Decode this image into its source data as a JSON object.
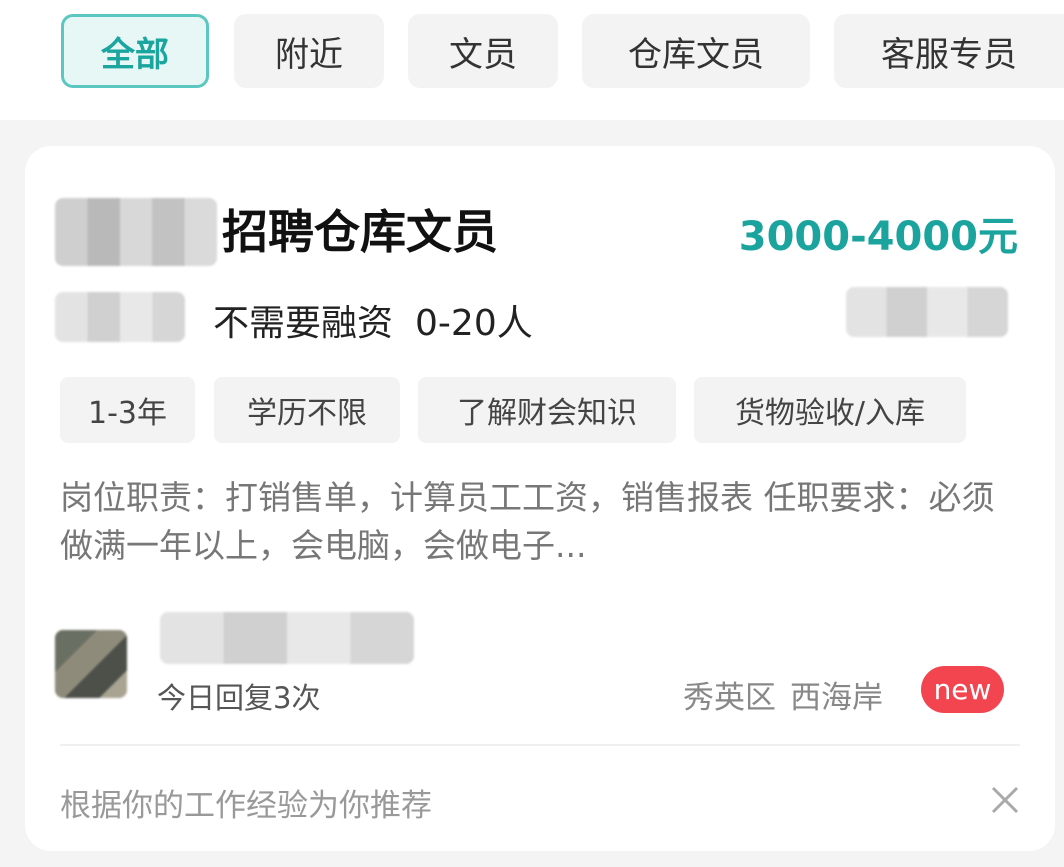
{
  "filters": [
    {
      "label": "全部",
      "active": true
    },
    {
      "label": "附近",
      "active": false
    },
    {
      "label": "文员",
      "active": false
    },
    {
      "label": "仓库文员",
      "active": false
    },
    {
      "label": "客服专员",
      "active": false
    }
  ],
  "job": {
    "title": "招聘仓库文员",
    "salary": "3000-4000元",
    "financing": "不需要融资",
    "company_size": "0-20人",
    "tags": [
      "1-3年",
      "学历不限",
      "了解财会知识",
      "货物验收/入库"
    ],
    "description": "岗位职责：打销售单，计算员工工资，销售报表 任职要求：必须做满一年以上，会电脑，会做电子...",
    "replies": "今日回复3次",
    "district": "秀英区",
    "area": "西海岸",
    "badge": "new",
    "recommend": "根据你的工作经验为你推荐"
  },
  "icons": {
    "close": "close-icon"
  },
  "colors": {
    "accent": "#1ba39d",
    "badge": "#f2454f"
  }
}
